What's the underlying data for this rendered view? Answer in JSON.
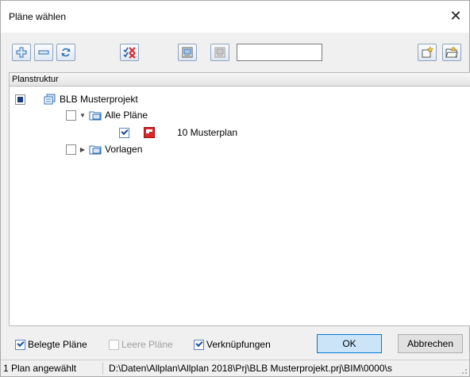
{
  "window": {
    "title": "Pläne wählen"
  },
  "search": {
    "value": ""
  },
  "tree": {
    "header": "Planstruktur",
    "root": {
      "label": "BLB Musterprojekt"
    },
    "folders": [
      {
        "label": "Alle Pläne",
        "expanded": true
      },
      {
        "label": "Vorlagen",
        "expanded": false
      }
    ],
    "plans": [
      {
        "label": "10 Musterplan",
        "checked": true
      }
    ]
  },
  "options": {
    "belegte": {
      "label": "Belegte Pläne",
      "checked": true
    },
    "leere": {
      "label": "Leere Pläne",
      "checked": false,
      "disabled": true
    },
    "verknuepfungen": {
      "label": "Verknüpfungen",
      "checked": true
    }
  },
  "buttons": {
    "ok": "OK",
    "cancel": "Abbrechen"
  },
  "status": {
    "left": "1 Plan angewählt",
    "path": "D:\\Daten\\Allplan\\Allplan 2018\\Prj\\BLB Musterprojekt.prj\\BIM\\0000\\s"
  },
  "colors": {
    "accent": "#0078d7",
    "plan_icon": "#d9262b",
    "folder": "#2f6fb5"
  }
}
